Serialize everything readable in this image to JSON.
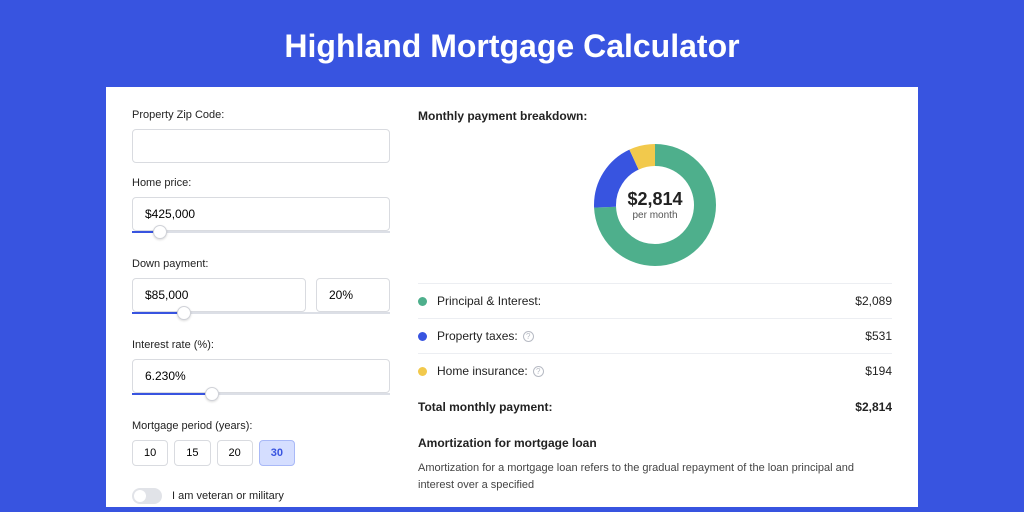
{
  "title": "Highland Mortgage Calculator",
  "form": {
    "zip_label": "Property Zip Code:",
    "zip_value": "",
    "home_price_label": "Home price:",
    "home_price_value": "$425,000",
    "home_price_slider_pct": 11,
    "down_payment_label": "Down payment:",
    "down_payment_value": "$85,000",
    "down_payment_pct_value": "20%",
    "down_payment_slider_pct": 20,
    "interest_label": "Interest rate (%):",
    "interest_value": "6.230%",
    "interest_slider_pct": 31,
    "period_label": "Mortgage period (years):",
    "period_options": [
      "10",
      "15",
      "20",
      "30"
    ],
    "period_active": "30",
    "veteran_label": "I am veteran or military"
  },
  "breakdown": {
    "header": "Monthly payment breakdown:",
    "donut_amount": "$2,814",
    "donut_sub": "per month",
    "items": [
      {
        "color": "#4eaf8c",
        "label": "Principal & Interest:",
        "amount": "$2,089",
        "info": false
      },
      {
        "color": "#3854e0",
        "label": "Property taxes:",
        "amount": "$531",
        "info": true
      },
      {
        "color": "#f2c94c",
        "label": "Home insurance:",
        "amount": "$194",
        "info": true
      }
    ],
    "total_label": "Total monthly payment:",
    "total_amount": "$2,814"
  },
  "amort": {
    "header": "Amortization for mortgage loan",
    "text": "Amortization for a mortgage loan refers to the gradual repayment of the loan principal and interest over a specified"
  },
  "chart_data": {
    "type": "pie",
    "title": "Monthly payment breakdown",
    "categories": [
      "Principal & Interest",
      "Property taxes",
      "Home insurance"
    ],
    "values": [
      2089,
      531,
      194
    ],
    "colors": [
      "#4eaf8c",
      "#3854e0",
      "#f2c94c"
    ],
    "total": 2814,
    "center_label": "$2,814 per month"
  }
}
